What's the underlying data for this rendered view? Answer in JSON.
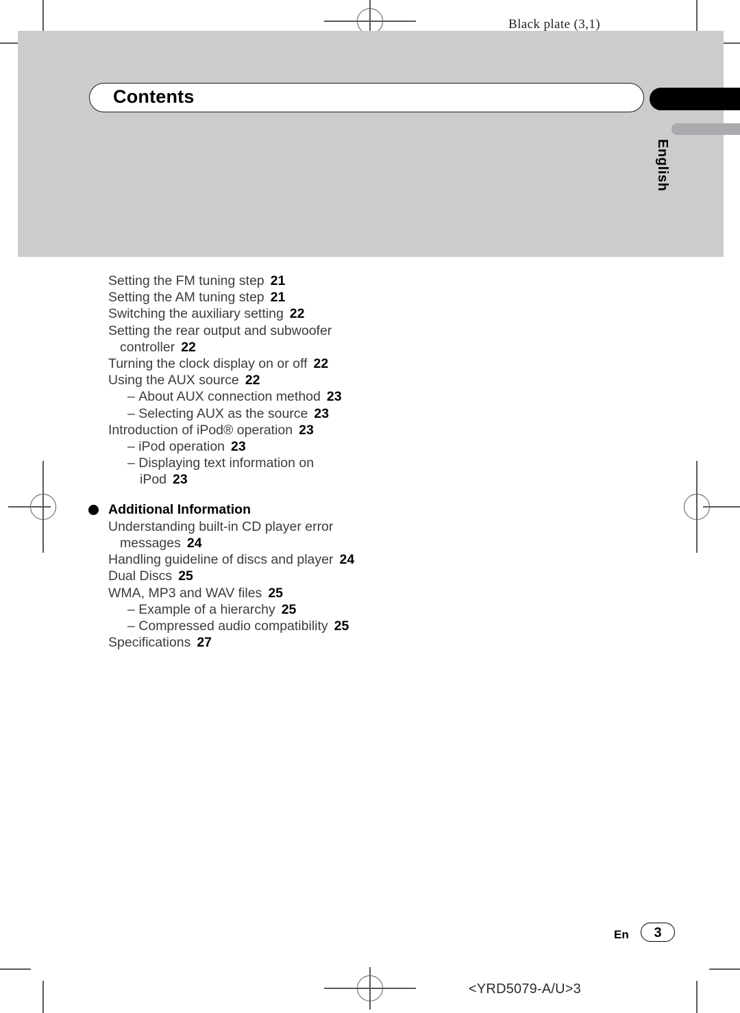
{
  "page": {
    "plate_label": "Black plate (3,1)",
    "title": "Contents",
    "language_tab": "English",
    "colors": {
      "panel_gray": "#cccccc",
      "tab_black": "#000000",
      "tab_gray": "#a9abae",
      "body_text": "#3b3b3b",
      "page_number": "#000000"
    }
  },
  "toc": {
    "entries": [
      {
        "label": "Setting the FM tuning step",
        "page": "21",
        "level": 0,
        "dash": false
      },
      {
        "label": "Setting the AM tuning step",
        "page": "21",
        "level": 0,
        "dash": false
      },
      {
        "label": "Switching the auxiliary setting",
        "page": "22",
        "level": 0,
        "dash": false
      },
      {
        "label": "Setting the rear output and subwoofer",
        "page": "",
        "level": 0,
        "dash": false
      },
      {
        "label": "controller",
        "page": "22",
        "level": 1,
        "dash": false
      },
      {
        "label": "Turning the clock display on or off",
        "page": "22",
        "level": 0,
        "dash": false
      },
      {
        "label": "Using the AUX source",
        "page": "22",
        "level": 0,
        "dash": false
      },
      {
        "label": "About AUX connection method",
        "page": "23",
        "level": 2,
        "dash": true
      },
      {
        "label": "Selecting AUX as the source",
        "page": "23",
        "level": 2,
        "dash": true
      },
      {
        "label": "Introduction of iPod® operation",
        "page": "23",
        "level": 0,
        "dash": false
      },
      {
        "label": "iPod operation",
        "page": "23",
        "level": 2,
        "dash": true
      },
      {
        "label": "Displaying text information on",
        "page": "",
        "level": 2,
        "dash": true
      },
      {
        "label": "iPod",
        "page": "23",
        "level": 3,
        "dash": false
      }
    ],
    "section_heading": "Additional Information",
    "entries_after_heading": [
      {
        "label": "Understanding built-in CD player error",
        "page": "",
        "level": 0,
        "dash": false
      },
      {
        "label": "messages",
        "page": "24",
        "level": 1,
        "dash": false
      },
      {
        "label": "Handling guideline of discs and player",
        "page": "24",
        "level": 0,
        "dash": false
      },
      {
        "label": "Dual Discs",
        "page": "25",
        "level": 0,
        "dash": false
      },
      {
        "label": "WMA, MP3 and WAV files",
        "page": "25",
        "level": 0,
        "dash": false
      },
      {
        "label": "Example of a hierarchy",
        "page": "25",
        "level": 2,
        "dash": true
      },
      {
        "label": "Compressed audio compatibility",
        "page": "25",
        "level": 2,
        "dash": true
      },
      {
        "label": "Specifications",
        "page": "27",
        "level": 0,
        "dash": false
      }
    ]
  },
  "footer": {
    "language_code": "En",
    "page_number": "3",
    "document_code": "<YRD5079-A/U>3"
  }
}
